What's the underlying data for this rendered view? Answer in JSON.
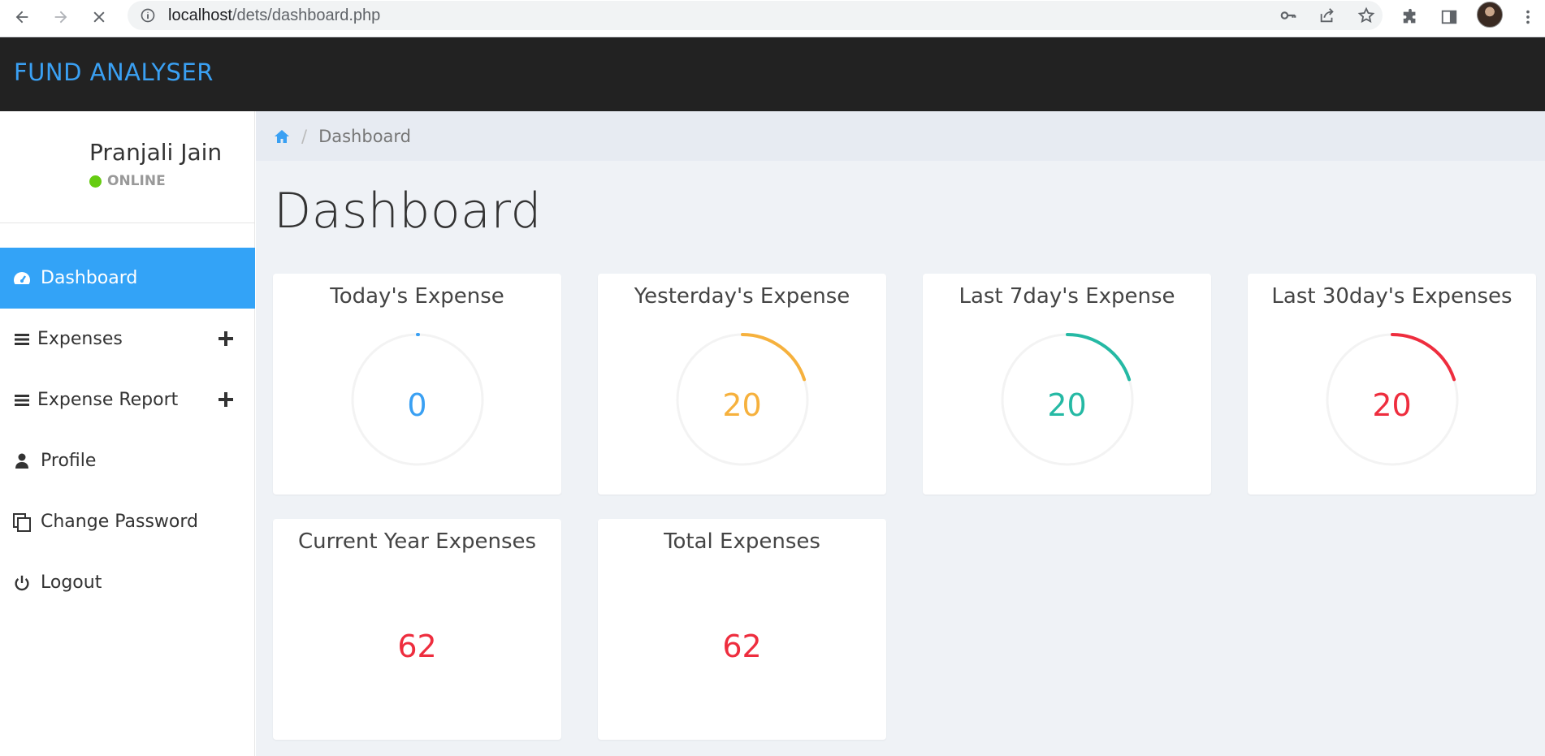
{
  "browser": {
    "url_host": "localhost",
    "url_path": "/dets/dashboard.php"
  },
  "app": {
    "brand": "FUND ANALYSER",
    "brand_color": "#3aa0f3"
  },
  "user": {
    "name": "Pranjali Jain",
    "status": "ONLINE"
  },
  "sidebar": {
    "items": [
      {
        "label": "Dashboard",
        "icon": "dashboard-gauge-icon",
        "active": true
      },
      {
        "label": "Expenses",
        "icon": "bars-icon",
        "expandable": true
      },
      {
        "label": "Expense Report",
        "icon": "bars-icon",
        "expandable": true
      },
      {
        "label": "Profile",
        "icon": "user-icon"
      },
      {
        "label": "Change Password",
        "icon": "copy-icon"
      },
      {
        "label": "Logout",
        "icon": "power-icon"
      }
    ]
  },
  "breadcrumb": {
    "home_icon": "home-icon",
    "current": "Dashboard"
  },
  "page": {
    "title": "Dashboard"
  },
  "cards": [
    {
      "title": "Today's Expense",
      "value": "0",
      "color": "#3aa0f3",
      "gauge_fraction": 0.0
    },
    {
      "title": "Yesterday's Expense",
      "value": "20",
      "color": "#f6b13d",
      "gauge_fraction": 0.2
    },
    {
      "title": "Last 7day's Expense",
      "value": "20",
      "color": "#25b9a4",
      "gauge_fraction": 0.2
    },
    {
      "title": "Last 30day's Expenses",
      "value": "20",
      "color": "#ee2d3e",
      "gauge_fraction": 0.2
    },
    {
      "title": "Current Year Expenses",
      "value": "62",
      "color": "#ee2d3e"
    },
    {
      "title": "Total Expenses",
      "value": "62",
      "color": "#ee2d3e"
    }
  ]
}
